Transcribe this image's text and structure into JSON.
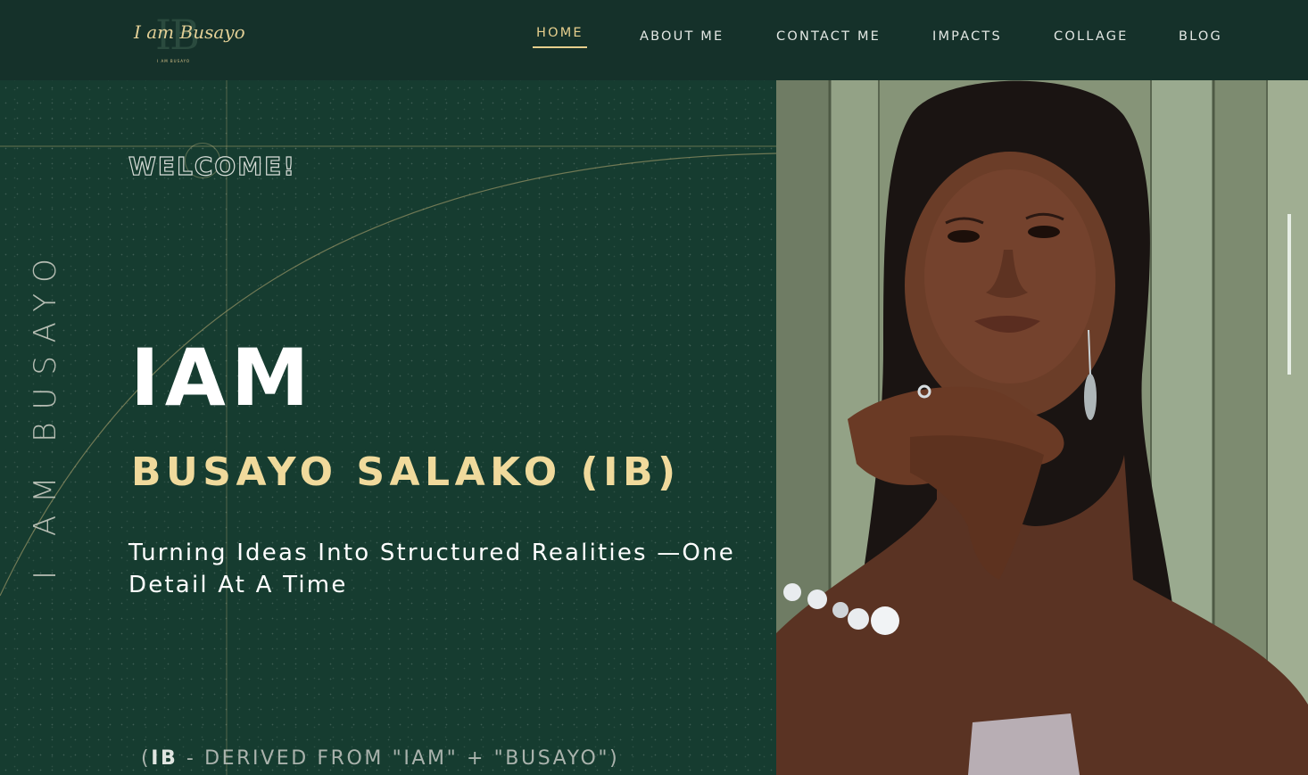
{
  "header": {
    "logo": {
      "script": "I am Busayo",
      "monogram": "IB",
      "subtitle": "I AM BUSAYO"
    },
    "nav": [
      {
        "label": "HOME",
        "active": true
      },
      {
        "label": "ABOUT ME",
        "active": false
      },
      {
        "label": "CONTACT ME",
        "active": false
      },
      {
        "label": "IMPACTS",
        "active": false
      },
      {
        "label": "COLLAGE",
        "active": false
      },
      {
        "label": "BLOG",
        "active": false
      }
    ]
  },
  "hero": {
    "vertical_text": "I AM BUSAYO",
    "welcome": "WELCOME!",
    "headline": "IAM",
    "name": "BUSAYO SALAKO (IB)",
    "tagline": "Turning Ideas Into Structured Realities —One Detail At A Time",
    "footnote_open": "(",
    "footnote_bold": "IB",
    "footnote_rest": " - DERIVED FROM \"IAM\" + \"BUSAYO\")",
    "photo_alt": "Portrait of Busayo Salako"
  },
  "colors": {
    "header_bg": "#15312a",
    "hero_bg": "#163c30",
    "accent_gold": "#e6cf8d",
    "name_gold": "#f0da9c",
    "text_white": "#ffffff"
  }
}
